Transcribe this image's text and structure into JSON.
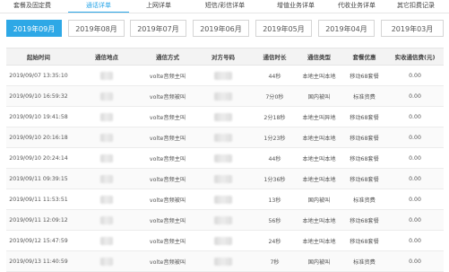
{
  "category_tabs": [
    {
      "label": "套餐及固定费",
      "active": false
    },
    {
      "label": "通话详单",
      "active": true
    },
    {
      "label": "上网详单",
      "active": false
    },
    {
      "label": "短信/彩信详单",
      "active": false
    },
    {
      "label": "增值业务详单",
      "active": false
    },
    {
      "label": "代收业务详单",
      "active": false
    },
    {
      "label": "其它扣费记录",
      "active": false
    }
  ],
  "months": [
    {
      "label": "2019年09月",
      "active": true
    },
    {
      "label": "2019年08月",
      "active": false
    },
    {
      "label": "2019年07月",
      "active": false
    },
    {
      "label": "2019年06月",
      "active": false
    },
    {
      "label": "2019年05月",
      "active": false
    },
    {
      "label": "2019年04月",
      "active": false
    },
    {
      "label": "2019年03月",
      "active": false
    }
  ],
  "table": {
    "headers": [
      "起始时间",
      "通信地点",
      "通信方式",
      "对方号码",
      "通信时长",
      "通信类型",
      "套餐优惠",
      "实收通信费(元)"
    ],
    "rows": [
      {
        "time": "2019/09/07 13:35:10",
        "method": "volte音频主叫",
        "duration": "44秒",
        "type": "本地主叫本地",
        "plan": "移动68套餐",
        "fee": "0.00"
      },
      {
        "time": "2019/09/10 16:59:32",
        "method": "volte音频被叫",
        "duration": "7分0秒",
        "type": "国内被叫",
        "plan": "标准资费",
        "fee": "0.00"
      },
      {
        "time": "2019/09/10 19:41:58",
        "method": "volte音频主叫",
        "duration": "2分18秒",
        "type": "本地主叫异地",
        "plan": "移动68套餐",
        "fee": "0.00"
      },
      {
        "time": "2019/09/10 20:16:18",
        "method": "volte音频主叫",
        "duration": "1分23秒",
        "type": "本地主叫本地",
        "plan": "移动68套餐",
        "fee": "0.00"
      },
      {
        "time": "2019/09/10 20:24:14",
        "method": "volte音频主叫",
        "duration": "44秒",
        "type": "本地主叫本地",
        "plan": "移动68套餐",
        "fee": "0.00"
      },
      {
        "time": "2019/09/11 09:39:15",
        "method": "volte音频主叫",
        "duration": "1分36秒",
        "type": "本地主叫本地",
        "plan": "移动68套餐",
        "fee": "0.00"
      },
      {
        "time": "2019/09/11 11:53:51",
        "method": "volte音频被叫",
        "duration": "13秒",
        "type": "国内被叫",
        "plan": "标准资费",
        "fee": "0.00"
      },
      {
        "time": "2019/09/11 12:09:12",
        "method": "volte音频主叫",
        "duration": "56秒",
        "type": "本地主叫本地",
        "plan": "移动68套餐",
        "fee": "0.00"
      },
      {
        "time": "2019/09/12 15:47:59",
        "method": "volte音频主叫",
        "duration": "24秒",
        "type": "本地主叫本地",
        "plan": "移动68套餐",
        "fee": "0.00"
      },
      {
        "time": "2019/09/13 11:40:59",
        "method": "volte音频被叫",
        "duration": "7秒",
        "type": "国内被叫",
        "plan": "标准资费",
        "fee": "0.00"
      }
    ]
  }
}
